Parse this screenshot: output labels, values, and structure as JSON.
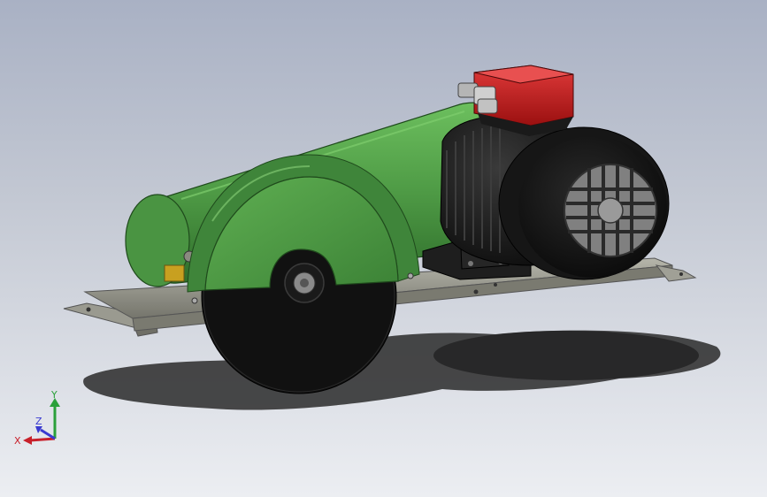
{
  "triad": {
    "x_label": "X",
    "y_label": "Y",
    "z_label": "Z",
    "x_color": "#c8202a",
    "y_color": "#2aa03a",
    "z_color": "#3a3ad0"
  },
  "colors": {
    "guard_green": "#4e9a45",
    "blade_black": "#141414",
    "motor_black": "#1c1c1c",
    "junction_box_red": "#c41c1c",
    "base_gray": "#8a8a80",
    "background_top": "#a9b1c4",
    "background_bottom": "#eceef2"
  }
}
